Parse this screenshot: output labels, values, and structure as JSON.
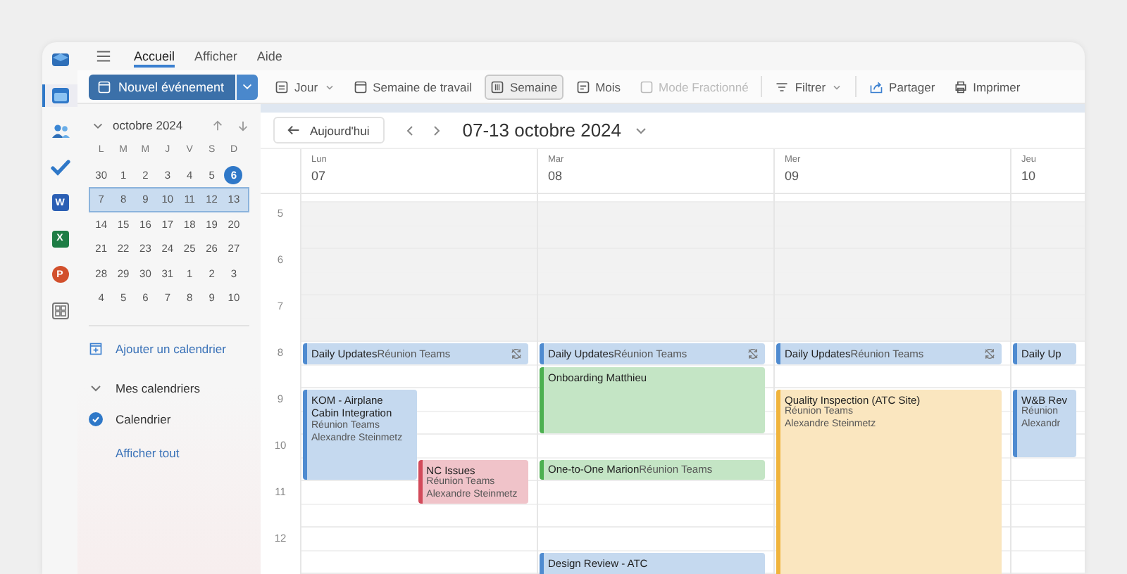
{
  "rail": [
    {
      "kind": "mail",
      "selected": false
    },
    {
      "kind": "calendar",
      "selected": true
    },
    {
      "kind": "people",
      "selected": false
    },
    {
      "kind": "todo",
      "selected": false
    },
    {
      "kind": "word",
      "letter": "W",
      "selected": false
    },
    {
      "kind": "excel",
      "letter": "X",
      "selected": false
    },
    {
      "kind": "powerpoint",
      "letter": "P",
      "selected": false
    },
    {
      "kind": "apps",
      "selected": false
    }
  ],
  "tabs": [
    {
      "label": "Accueil",
      "selected": true
    },
    {
      "label": "Afficher",
      "selected": false
    },
    {
      "label": "Aide",
      "selected": false
    }
  ],
  "toolbar": {
    "new_event": "Nouvel événement",
    "views": [
      {
        "label": "Jour",
        "dropdown": true,
        "selected": false,
        "disabled": false
      },
      {
        "label": "Semaine de travail",
        "dropdown": false,
        "selected": false,
        "disabled": false
      },
      {
        "label": "Semaine",
        "dropdown": false,
        "selected": true,
        "disabled": false
      },
      {
        "label": "Mois",
        "dropdown": false,
        "selected": false,
        "disabled": false
      },
      {
        "label": "Mode Fractionné",
        "dropdown": false,
        "selected": false,
        "disabled": true
      }
    ],
    "actions": [
      {
        "label": "Filtrer",
        "dropdown": true
      },
      {
        "label": "Partager",
        "dropdown": false
      },
      {
        "label": "Imprimer",
        "dropdown": false
      }
    ]
  },
  "mini_calendar": {
    "month": "octobre 2024",
    "weekdays": [
      "L",
      "M",
      "M",
      "J",
      "V",
      "S",
      "D"
    ],
    "weeks": [
      {
        "selected": false,
        "days": [
          {
            "label": "30",
            "today": false
          },
          {
            "label": "1",
            "today": false
          },
          {
            "label": "2",
            "today": false
          },
          {
            "label": "3",
            "today": false
          },
          {
            "label": "4",
            "today": false
          },
          {
            "label": "5",
            "today": false
          },
          {
            "label": "6",
            "today": true
          }
        ]
      },
      {
        "selected": true,
        "days": [
          {
            "label": "7",
            "today": false
          },
          {
            "label": "8",
            "today": false
          },
          {
            "label": "9",
            "today": false
          },
          {
            "label": "10",
            "today": false
          },
          {
            "label": "11",
            "today": false
          },
          {
            "label": "12",
            "today": false
          },
          {
            "label": "13",
            "today": false
          }
        ]
      },
      {
        "selected": false,
        "days": [
          {
            "label": "14",
            "today": false
          },
          {
            "label": "15",
            "today": false
          },
          {
            "label": "16",
            "today": false
          },
          {
            "label": "17",
            "today": false
          },
          {
            "label": "18",
            "today": false
          },
          {
            "label": "19",
            "today": false
          },
          {
            "label": "20",
            "today": false
          }
        ]
      },
      {
        "selected": false,
        "days": [
          {
            "label": "21",
            "today": false
          },
          {
            "label": "22",
            "today": false
          },
          {
            "label": "23",
            "today": false
          },
          {
            "label": "24",
            "today": false
          },
          {
            "label": "25",
            "today": false
          },
          {
            "label": "26",
            "today": false
          },
          {
            "label": "27",
            "today": false
          }
        ]
      },
      {
        "selected": false,
        "days": [
          {
            "label": "28",
            "today": false
          },
          {
            "label": "29",
            "today": false
          },
          {
            "label": "30",
            "today": false
          },
          {
            "label": "31",
            "today": false
          },
          {
            "label": "1",
            "today": false
          },
          {
            "label": "2",
            "today": false
          },
          {
            "label": "3",
            "today": false
          }
        ]
      },
      {
        "selected": false,
        "days": [
          {
            "label": "4",
            "today": false
          },
          {
            "label": "5",
            "today": false
          },
          {
            "label": "6",
            "today": false
          },
          {
            "label": "7",
            "today": false
          },
          {
            "label": "8",
            "today": false
          },
          {
            "label": "9",
            "today": false
          },
          {
            "label": "10",
            "today": false
          }
        ]
      }
    ]
  },
  "sidebar": {
    "add_calendar": "Ajouter un calendrier",
    "group": {
      "label": "Mes calendriers",
      "expanded": true
    },
    "calendars": [
      {
        "label": "Calendrier",
        "checked": true
      }
    ],
    "show_all": "Afficher tout"
  },
  "nav": {
    "today": "Aujourd'hui",
    "range": "07-13 octobre 2024"
  },
  "hours": [
    {
      "label": "5",
      "working": false
    },
    {
      "label": "6",
      "working": false
    },
    {
      "label": "7",
      "working": false
    },
    {
      "label": "8",
      "working": true
    },
    {
      "label": "9",
      "working": true
    },
    {
      "label": "10",
      "working": true
    },
    {
      "label": "11",
      "working": true
    },
    {
      "label": "12",
      "working": true
    }
  ],
  "days": [
    {
      "name": "Lun",
      "date": "07",
      "events": [
        {
          "kind": "inline",
          "title": "Daily Updates",
          "location": "Réunion Teams",
          "color": "#4f8bd0",
          "recurring": true
        },
        {
          "kind": "block",
          "title": "KOM - Airplane Cabin Integration",
          "location": "Réunion Teams",
          "organizer": "Alexandre Steinmetz",
          "color": "#4f8bd0",
          "recurring": false
        },
        {
          "kind": "block",
          "title": "NC Issues",
          "location": "Réunion Teams",
          "organizer": "Alexandre Steinmetz",
          "color": "#d24a5a",
          "recurring": false
        }
      ]
    },
    {
      "name": "Mar",
      "date": "08",
      "events": [
        {
          "kind": "inline",
          "title": "Daily Updates",
          "location": "Réunion Teams",
          "color": "#4f8bd0",
          "recurring": true
        },
        {
          "kind": "block",
          "title": "Onboarding Matthieu",
          "color": "#4cb050",
          "recurring": false
        },
        {
          "kind": "inline",
          "title": "One-to-One Marion",
          "location": "Réunion Teams",
          "color": "#4cb050",
          "recurring": false
        },
        {
          "kind": "block",
          "title": "Design Review - ATC",
          "color": "#4f8bd0",
          "recurring": false
        }
      ]
    },
    {
      "name": "Mer",
      "date": "09",
      "events": [
        {
          "kind": "inline",
          "title": "Daily Updates",
          "location": "Réunion Teams",
          "color": "#4f8bd0",
          "recurring": true
        },
        {
          "kind": "block",
          "title": "Quality Inspection (ATC Site)",
          "location": "Réunion Teams",
          "organizer": "Alexandre Steinmetz",
          "color": "#f0b43c",
          "recurring": false
        }
      ]
    },
    {
      "name": "Jeu",
      "date": "10",
      "events": [
        {
          "kind": "inline",
          "title": "Daily Up",
          "color": "#4f8bd0",
          "recurring": false
        },
        {
          "kind": "block",
          "title": "W&B Rev",
          "location": "Réunion",
          "organizer": "Alexandr",
          "color": "#4f8bd0",
          "recurring": false
        }
      ]
    }
  ]
}
